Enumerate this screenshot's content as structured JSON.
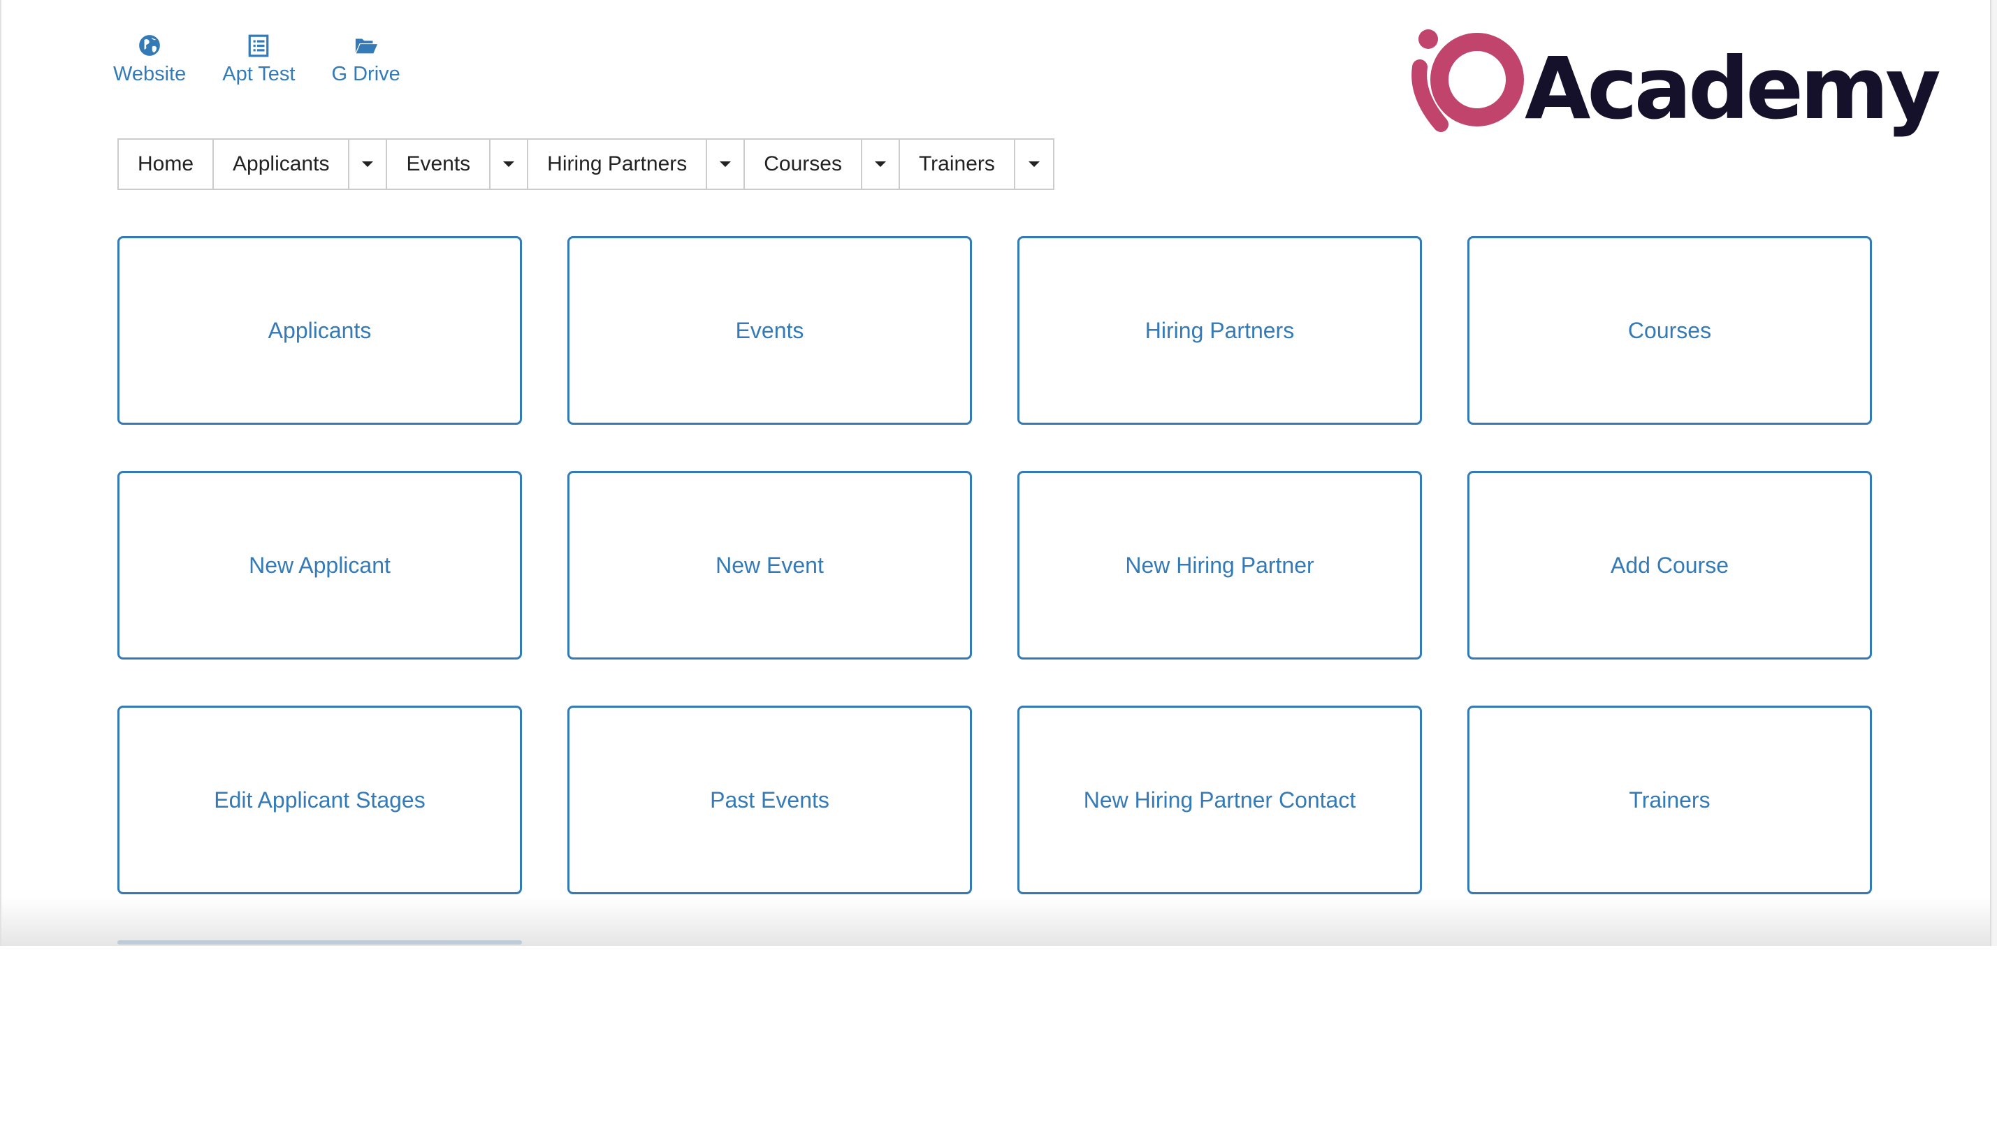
{
  "quicklinks": [
    {
      "label": "Website",
      "icon": "globe-icon"
    },
    {
      "label": "Apt Test",
      "icon": "list-icon"
    },
    {
      "label": "G Drive",
      "icon": "folder-open-icon"
    }
  ],
  "logo": {
    "text": "Academy",
    "brand_color": "#c0446b",
    "text_color": "#15112b"
  },
  "nav": {
    "home": "Home",
    "applicants": "Applicants",
    "events": "Events",
    "hiring_partners": "Hiring Partners",
    "courses": "Courses",
    "trainers": "Trainers"
  },
  "tiles": [
    "Applicants",
    "Events",
    "Hiring Partners",
    "Courses",
    "New Applicant",
    "New Event",
    "New Hiring Partner",
    "Add Course",
    "Edit Applicant Stages",
    "Past Events",
    "New Hiring Partner Contact",
    "Trainers"
  ],
  "colors": {
    "link": "#337ab7",
    "border": "#cccccc"
  }
}
